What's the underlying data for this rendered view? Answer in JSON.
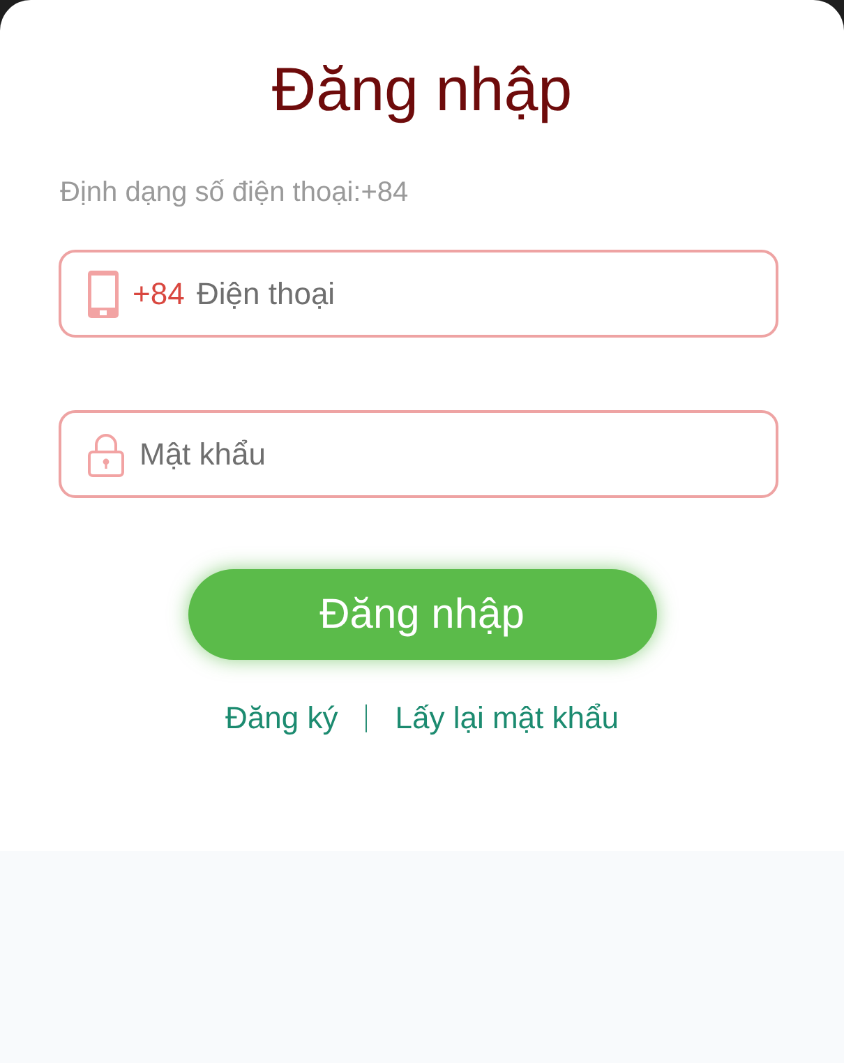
{
  "title": "Đăng nhập",
  "hint": "Định dạng số điện thoại:+84",
  "fields": [
    {
      "kind": "phone",
      "prefix": "+84",
      "placeholder": "Điện thoại"
    },
    {
      "kind": "password",
      "placeholder": "Mật khẩu"
    }
  ],
  "submit_button": "Đăng nhập",
  "links": [
    "Đăng ký",
    "Lấy lại mật khẩu"
  ]
}
